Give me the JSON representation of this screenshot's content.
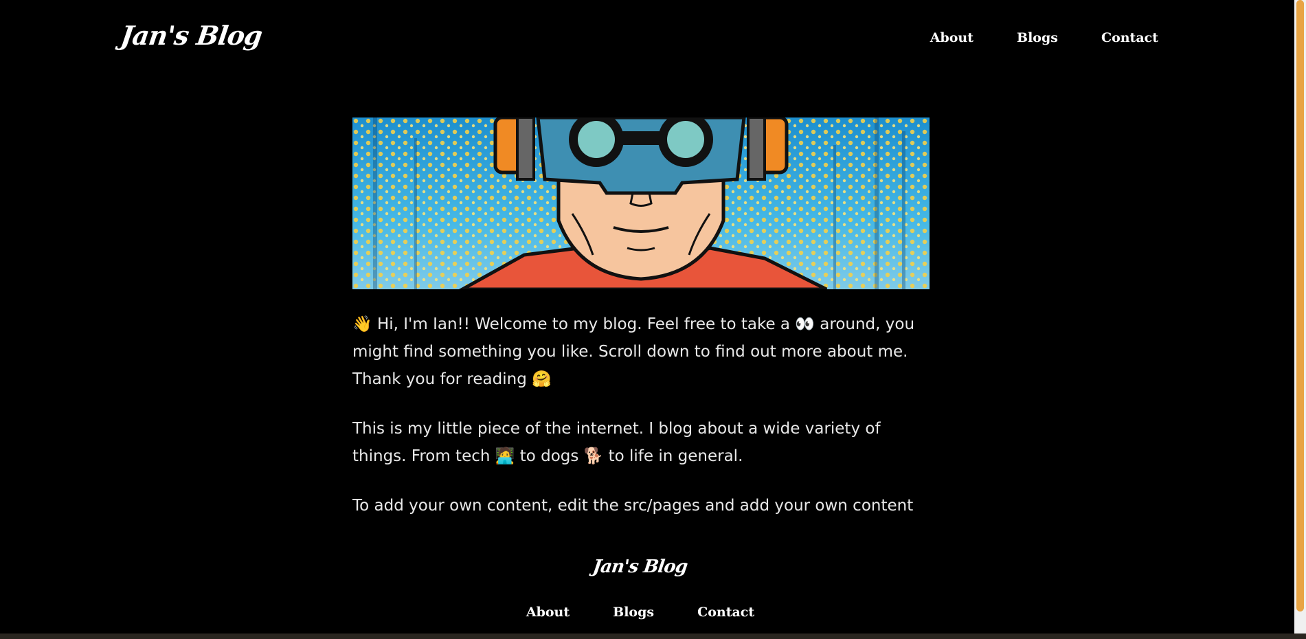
{
  "site": {
    "logo": "Jan's Blog"
  },
  "nav": {
    "items": [
      {
        "label": "About"
      },
      {
        "label": "Blogs"
      },
      {
        "label": "Contact"
      }
    ]
  },
  "hero": {
    "icon": "comic-avatar-image"
  },
  "content": {
    "paragraphs": [
      "👋 Hi, I'm Ian!! Welcome to my blog. Feel free to take a 👀 around, you might find something you like. Scroll down to find out more about me. Thank you for reading 🤗",
      "This is my little piece of the internet. I blog about a wide variety of things. From tech 🧑‍💻 to dogs 🐕 to life in general.",
      "To add your own content, edit the src/pages and add your own content"
    ]
  },
  "footer": {
    "logo": "Jan's Blog",
    "nav": [
      {
        "label": "About"
      },
      {
        "label": "Blogs"
      },
      {
        "label": "Contact"
      }
    ]
  },
  "colors": {
    "background": "#000000",
    "text": "#e8e8e8",
    "scrollbar_thumb": "#e8a444"
  }
}
